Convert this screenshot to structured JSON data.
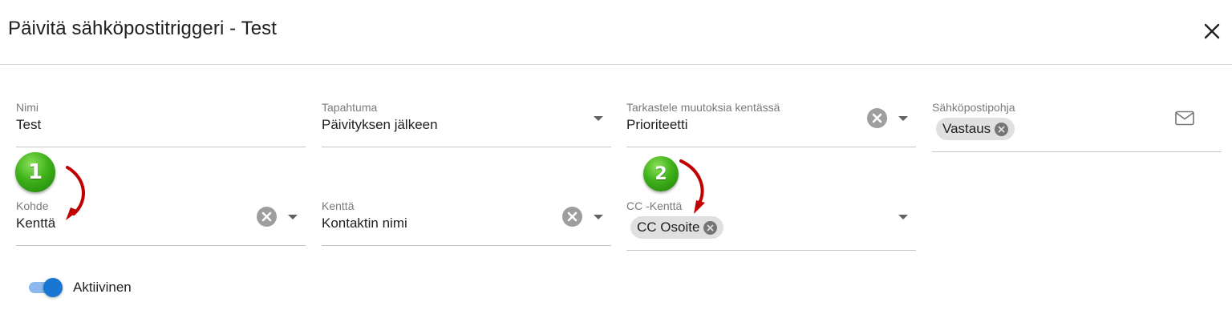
{
  "dialog": {
    "title": "Päivitä sähköpostitriggeri - Test"
  },
  "fields": {
    "name": {
      "label": "Nimi",
      "value": "Test"
    },
    "event": {
      "label": "Tapahtuma",
      "value": "Päivityksen jälkeen"
    },
    "watch_field": {
      "label": "Tarkastele muutoksia kentässä",
      "value": "Prioriteetti"
    },
    "email_template": {
      "label": "Sähköpostipohja",
      "chip": "Vastaus"
    },
    "target": {
      "label": "Kohde",
      "value": "Kenttä"
    },
    "field": {
      "label": "Kenttä",
      "value": "Kontaktin nimi"
    },
    "cc_field": {
      "label": "CC -Kenttä",
      "chip": "CC Osoite"
    }
  },
  "toggle": {
    "label": "Aktiivinen",
    "checked": true
  },
  "annotations": {
    "badge1": "1",
    "badge2": "2"
  },
  "colors": {
    "accent": "#1976d2",
    "annotation_arrow": "#c00000",
    "badge_green": "#3fb21a"
  }
}
